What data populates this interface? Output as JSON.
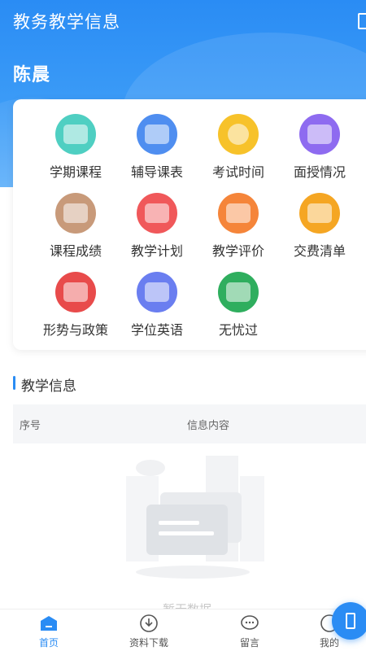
{
  "header": {
    "title": "教务教学信息",
    "scan_icon": "scan-icon"
  },
  "user": {
    "name": "陈晨"
  },
  "menu": {
    "items": [
      {
        "label": "学期课程",
        "icon": "book-icon",
        "color": "#4fcfc2"
      },
      {
        "label": "辅导课表",
        "icon": "schedule-icon",
        "color": "#4f8ef0"
      },
      {
        "label": "考试时间",
        "icon": "alarm-clock-icon",
        "color": "#f7c22a"
      },
      {
        "label": "面授情况",
        "icon": "blackboard-icon",
        "color": "#8e6bf0"
      },
      {
        "label": "课程成绩",
        "icon": "grade-icon",
        "color": "#c89a7a"
      },
      {
        "label": "教学计划",
        "icon": "calendar-check-icon",
        "color": "#f0585a"
      },
      {
        "label": "教学评价",
        "icon": "star-rating-icon",
        "color": "#f5853a"
      },
      {
        "label": "交费清单",
        "icon": "payment-icon",
        "color": "#f5a623"
      },
      {
        "label": "形势与政策",
        "icon": "policy-icon",
        "color": "#e84b4b"
      },
      {
        "label": "学位英语",
        "icon": "english-icon",
        "color": "#6a7ef0"
      },
      {
        "label": "无忧过",
        "icon": "pass-icon",
        "color": "#2fae5e"
      }
    ]
  },
  "info_section": {
    "title": "教学信息",
    "columns": {
      "seq": "序号",
      "content": "信息内容"
    },
    "empty_text": "暂无数据"
  },
  "tabbar": {
    "tabs": [
      {
        "label": "首页",
        "icon": "home-icon",
        "active": true
      },
      {
        "label": "资料下载",
        "icon": "download-icon",
        "active": false
      },
      {
        "label": "留言",
        "icon": "message-icon",
        "active": false
      },
      {
        "label": "我的",
        "icon": "profile-icon",
        "active": false
      }
    ]
  },
  "colors": {
    "primary": "#2a8cf4"
  }
}
